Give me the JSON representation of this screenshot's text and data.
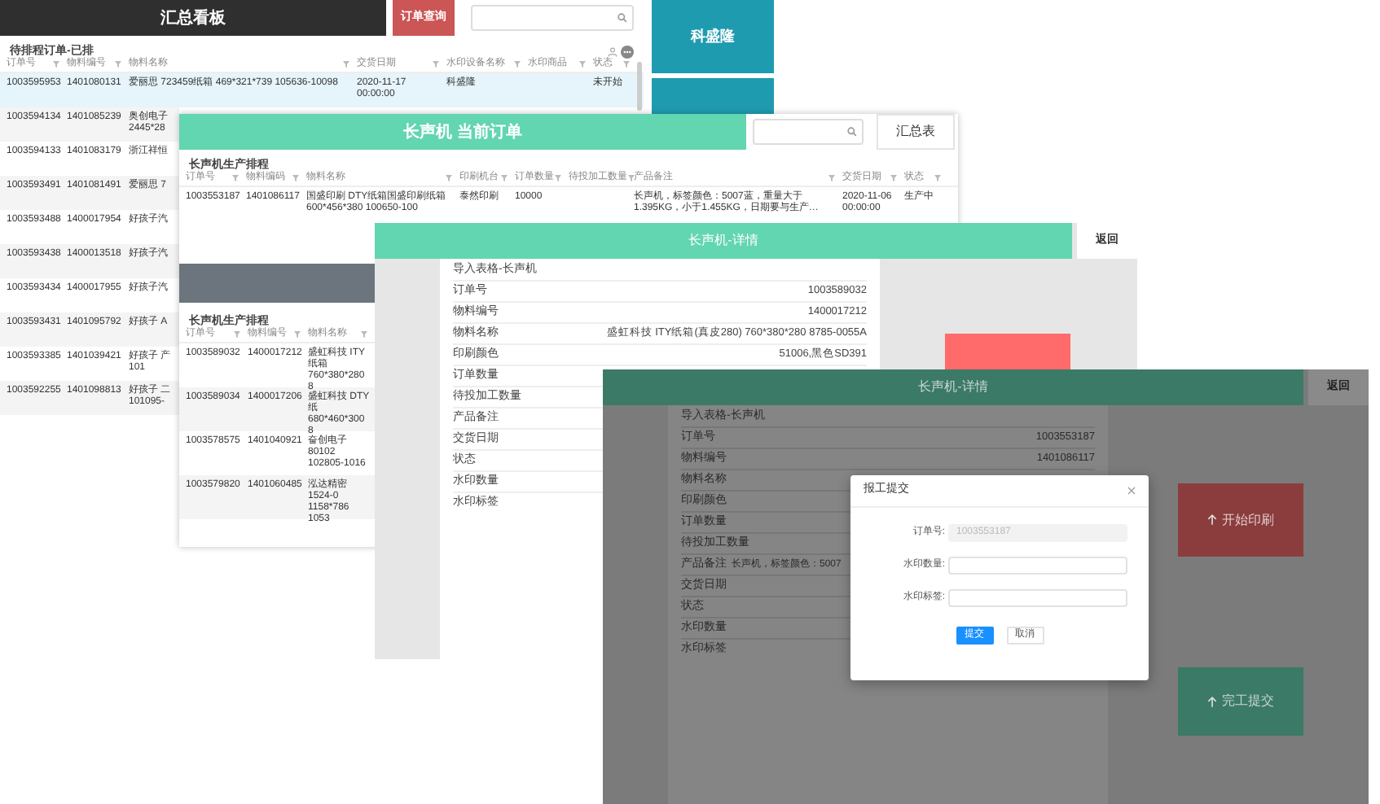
{
  "summary_window": {
    "title": "汇总看板",
    "query_button": "订单查询",
    "tiles": [
      {
        "label": "科盛隆"
      }
    ],
    "table": {
      "title": "待排程订单-已排",
      "columns": [
        "订单号",
        "物料编号",
        "物料名称",
        "交货日期",
        "水印设备名称",
        "水印商品",
        "状态"
      ],
      "rows": [
        {
          "selected": true,
          "cells": [
            "1003595953",
            "1401080131",
            "爱丽思 723459纸箱 469*321*739 105636-10098",
            "2020-11-17 00:00:00",
            "科盛隆",
            "",
            "未开始"
          ]
        },
        {
          "selected": false,
          "cells": [
            "1003594134",
            "1401085239",
            "奥创电子 2445*28"
          ]
        },
        {
          "selected": false,
          "cells": [
            "1003594133",
            "1401083179",
            "浙江祥恒"
          ]
        },
        {
          "selected": false,
          "cells": [
            "1003593491",
            "1401081491",
            "爱丽思 7"
          ]
        },
        {
          "selected": false,
          "cells": [
            "1003593488",
            "1400017954",
            "好孩子汽"
          ]
        },
        {
          "selected": false,
          "cells": [
            "1003593438",
            "1400013518",
            "好孩子汽"
          ]
        },
        {
          "selected": false,
          "cells": [
            "1003593434",
            "1400017955",
            "好孩子汽"
          ]
        },
        {
          "selected": false,
          "cells": [
            "1003593431",
            "1401095792",
            "好孩子 A"
          ]
        },
        {
          "selected": false,
          "cells": [
            "1003593385",
            "1401039421",
            "好孩子 产 101"
          ]
        },
        {
          "selected": false,
          "cells": [
            "1003592255",
            "1401098813",
            "好孩子 二 101095-"
          ]
        }
      ]
    }
  },
  "order_window": {
    "title": "长声机 当前订单",
    "summary_button": "汇总表",
    "table": {
      "title": "长声机生产排程",
      "columns": [
        "订单号",
        "物料编码",
        "物料名称",
        "印刷机台",
        "订单数量",
        "待投加工数量",
        "产品备注",
        "交货日期",
        "状态"
      ],
      "rows": [
        {
          "selected": false,
          "cells": [
            "1003553187",
            "1401086117",
            "国盛印刷 DTY纸箱国盛印刷纸箱 600*456*380 100650-100",
            "泰然印刷",
            "10000",
            "",
            "长声机，标签颜色：5007蓝，重量大于1.395KG，小于1.455KG，日期要与生产…",
            "2020-11-06 00:00:00",
            "生产中"
          ]
        }
      ]
    },
    "second_table": {
      "title": "长声机生产排程",
      "columns": [
        "订单号",
        "物料编号",
        "物料名称"
      ],
      "rows": [
        {
          "selected": false,
          "cells": [
            "1003589032",
            "1400017212",
            "盛虹科技 ITY纸箱 760*380*280 8"
          ]
        },
        {
          "selected": false,
          "cells": [
            "1003589034",
            "1400017206",
            "盛虹科技 DTY纸 680*460*300 8"
          ]
        },
        {
          "selected": false,
          "cells": [
            "1003578575",
            "1401040921",
            "奋创电子 80102 102805-1016"
          ]
        },
        {
          "selected": false,
          "cells": [
            "1003579820",
            "1401060485",
            "泓达精密 1524-0 1158*786 1053"
          ]
        }
      ]
    }
  },
  "detail_window": {
    "title": "长声机-详情",
    "back_button": "返回",
    "card_title": "导入表格-长声机",
    "fields": [
      {
        "label": "订单号",
        "value": "1003589032"
      },
      {
        "label": "物料编号",
        "value": "1400017212"
      },
      {
        "label": "物料名称",
        "value": "盛虹科技 ITY纸箱(真皮280) 760*380*280 8785-0055A"
      },
      {
        "label": "印刷颜色",
        "value": "51006,黑色SD391"
      },
      {
        "label": "订单数量"
      },
      {
        "label": "待投加工数量"
      },
      {
        "label": "产品备注"
      },
      {
        "label": "交货日期"
      },
      {
        "label": "状态"
      },
      {
        "label": "水印数量"
      },
      {
        "label": "水印标签"
      }
    ]
  },
  "dimmed_detail_window": {
    "title": "长声机-详情",
    "back_button": "返回",
    "card_title": "导入表格-长声机",
    "fields": [
      {
        "label": "订单号",
        "value": "1003553187"
      },
      {
        "label": "物料编号",
        "value": "1401086117"
      },
      {
        "label": "物料名称"
      },
      {
        "label": "印刷颜色"
      },
      {
        "label": "订单数量"
      },
      {
        "label": "待投加工数量"
      },
      {
        "label": "产品备注",
        "value": "长声机，标签颜色：5007",
        "kind": "note"
      },
      {
        "label": "交货日期"
      },
      {
        "label": "状态"
      },
      {
        "label": "水印数量"
      },
      {
        "label": "水印标签"
      }
    ],
    "start_button": "开始印刷",
    "finish_button": "完工提交",
    "dialog": {
      "title": "报工提交",
      "fields": [
        {
          "label": "订单号:",
          "value": "1003553187",
          "disabled": true
        },
        {
          "label": "水印数量:",
          "disabled": false
        },
        {
          "label": "水印标签:",
          "disabled": false
        }
      ],
      "submit_button": "提交",
      "cancel_button": "取消"
    }
  }
}
